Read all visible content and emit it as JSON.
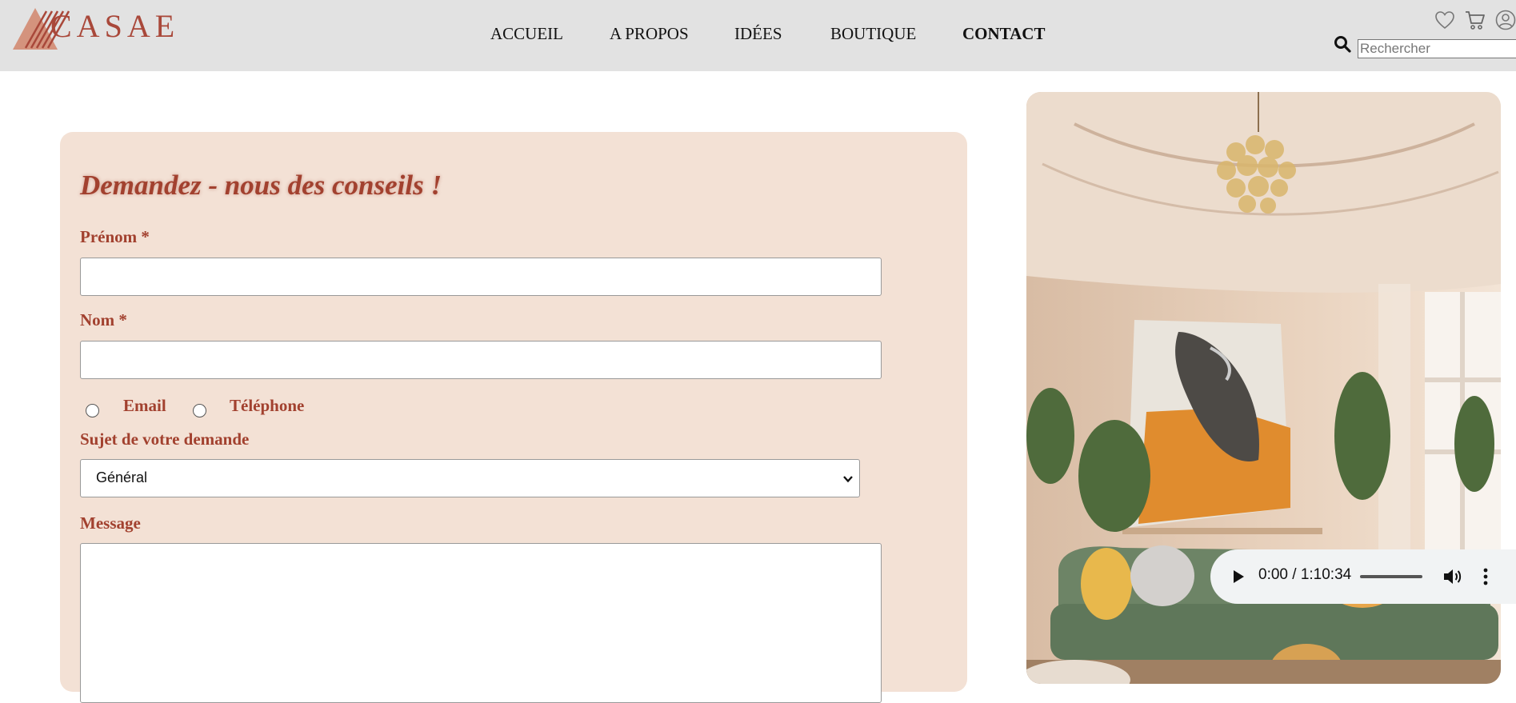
{
  "brand": {
    "name": "CASAE"
  },
  "nav": {
    "items": [
      {
        "label": "ACCUEIL",
        "active": false
      },
      {
        "label": "A PROPOS",
        "active": false
      },
      {
        "label": "IDÉES",
        "active": false
      },
      {
        "label": "BOUTIQUE",
        "active": false
      },
      {
        "label": "CONTACT",
        "active": true
      }
    ]
  },
  "header_icons": [
    "heart-icon",
    "cart-icon",
    "user-icon"
  ],
  "search": {
    "placeholder": "Rechercher",
    "value": ""
  },
  "form": {
    "title": "Demandez - nous des conseils !",
    "first_name": {
      "label": "Prénom *",
      "value": ""
    },
    "last_name": {
      "label": "Nom *",
      "value": ""
    },
    "contact_options": [
      {
        "label": "Email",
        "checked": false
      },
      {
        "label": "Téléphone",
        "checked": false
      }
    ],
    "subject": {
      "label": "Sujet de votre demande",
      "selected": "Général"
    },
    "message": {
      "label": "Message",
      "value": ""
    }
  },
  "audio": {
    "time": "0:00 / 1:10:34"
  },
  "colors": {
    "accent": "#a2412f",
    "panel": "#f3e1d5",
    "header": "#e2e2e2",
    "logo": "#cf8e79"
  }
}
